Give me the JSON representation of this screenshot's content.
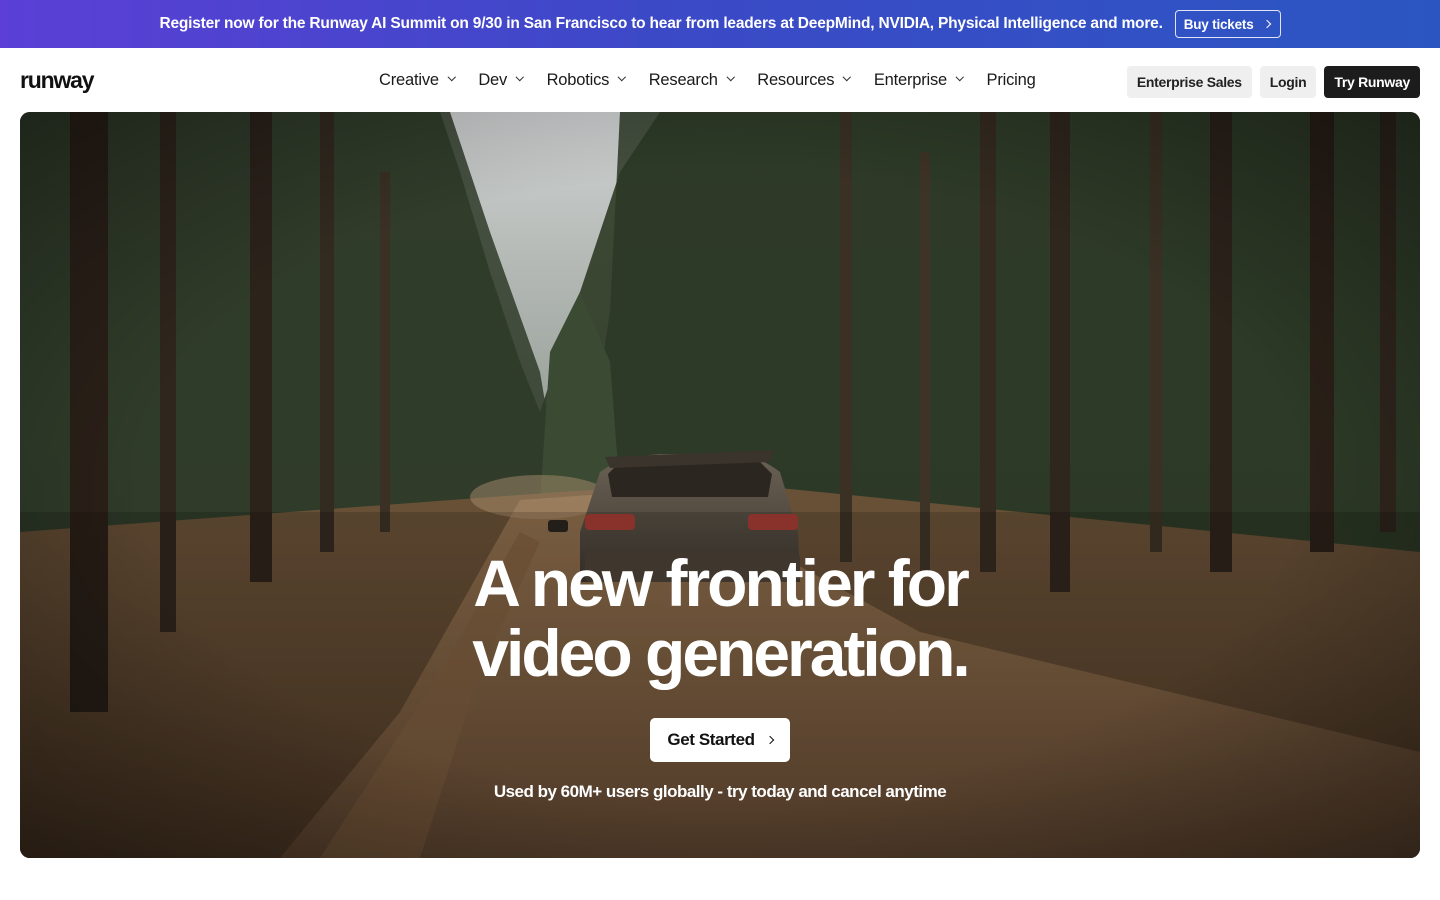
{
  "announcement": {
    "text": "Register now for the Runway AI Summit on 9/30 in San Francisco to hear from leaders at DeepMind, NVIDIA, Physical Intelligence and more.",
    "button_label": "Buy tickets"
  },
  "header": {
    "logo": "runway",
    "nav": [
      {
        "label": "Creative"
      },
      {
        "label": "Dev"
      },
      {
        "label": "Robotics"
      },
      {
        "label": "Research"
      },
      {
        "label": "Resources"
      },
      {
        "label": "Enterprise"
      },
      {
        "label": "Pricing"
      }
    ],
    "enterprise_sales": "Enterprise Sales",
    "login": "Login",
    "try_runway": "Try Runway"
  },
  "hero": {
    "title_line1": "A new frontier for",
    "title_line2": "video generation.",
    "cta_label": "Get Started",
    "subtitle": "Used by 60M+ users globally - try today and cancel anytime"
  },
  "icons": {
    "chevron": "chevron-down-icon",
    "arrow": "chevron-right-icon"
  },
  "colors": {
    "announce_start": "#5b3fd6",
    "announce_end": "#2b56c2",
    "primary_dark": "#1c1c1c",
    "secondary_grey": "#efefef"
  }
}
